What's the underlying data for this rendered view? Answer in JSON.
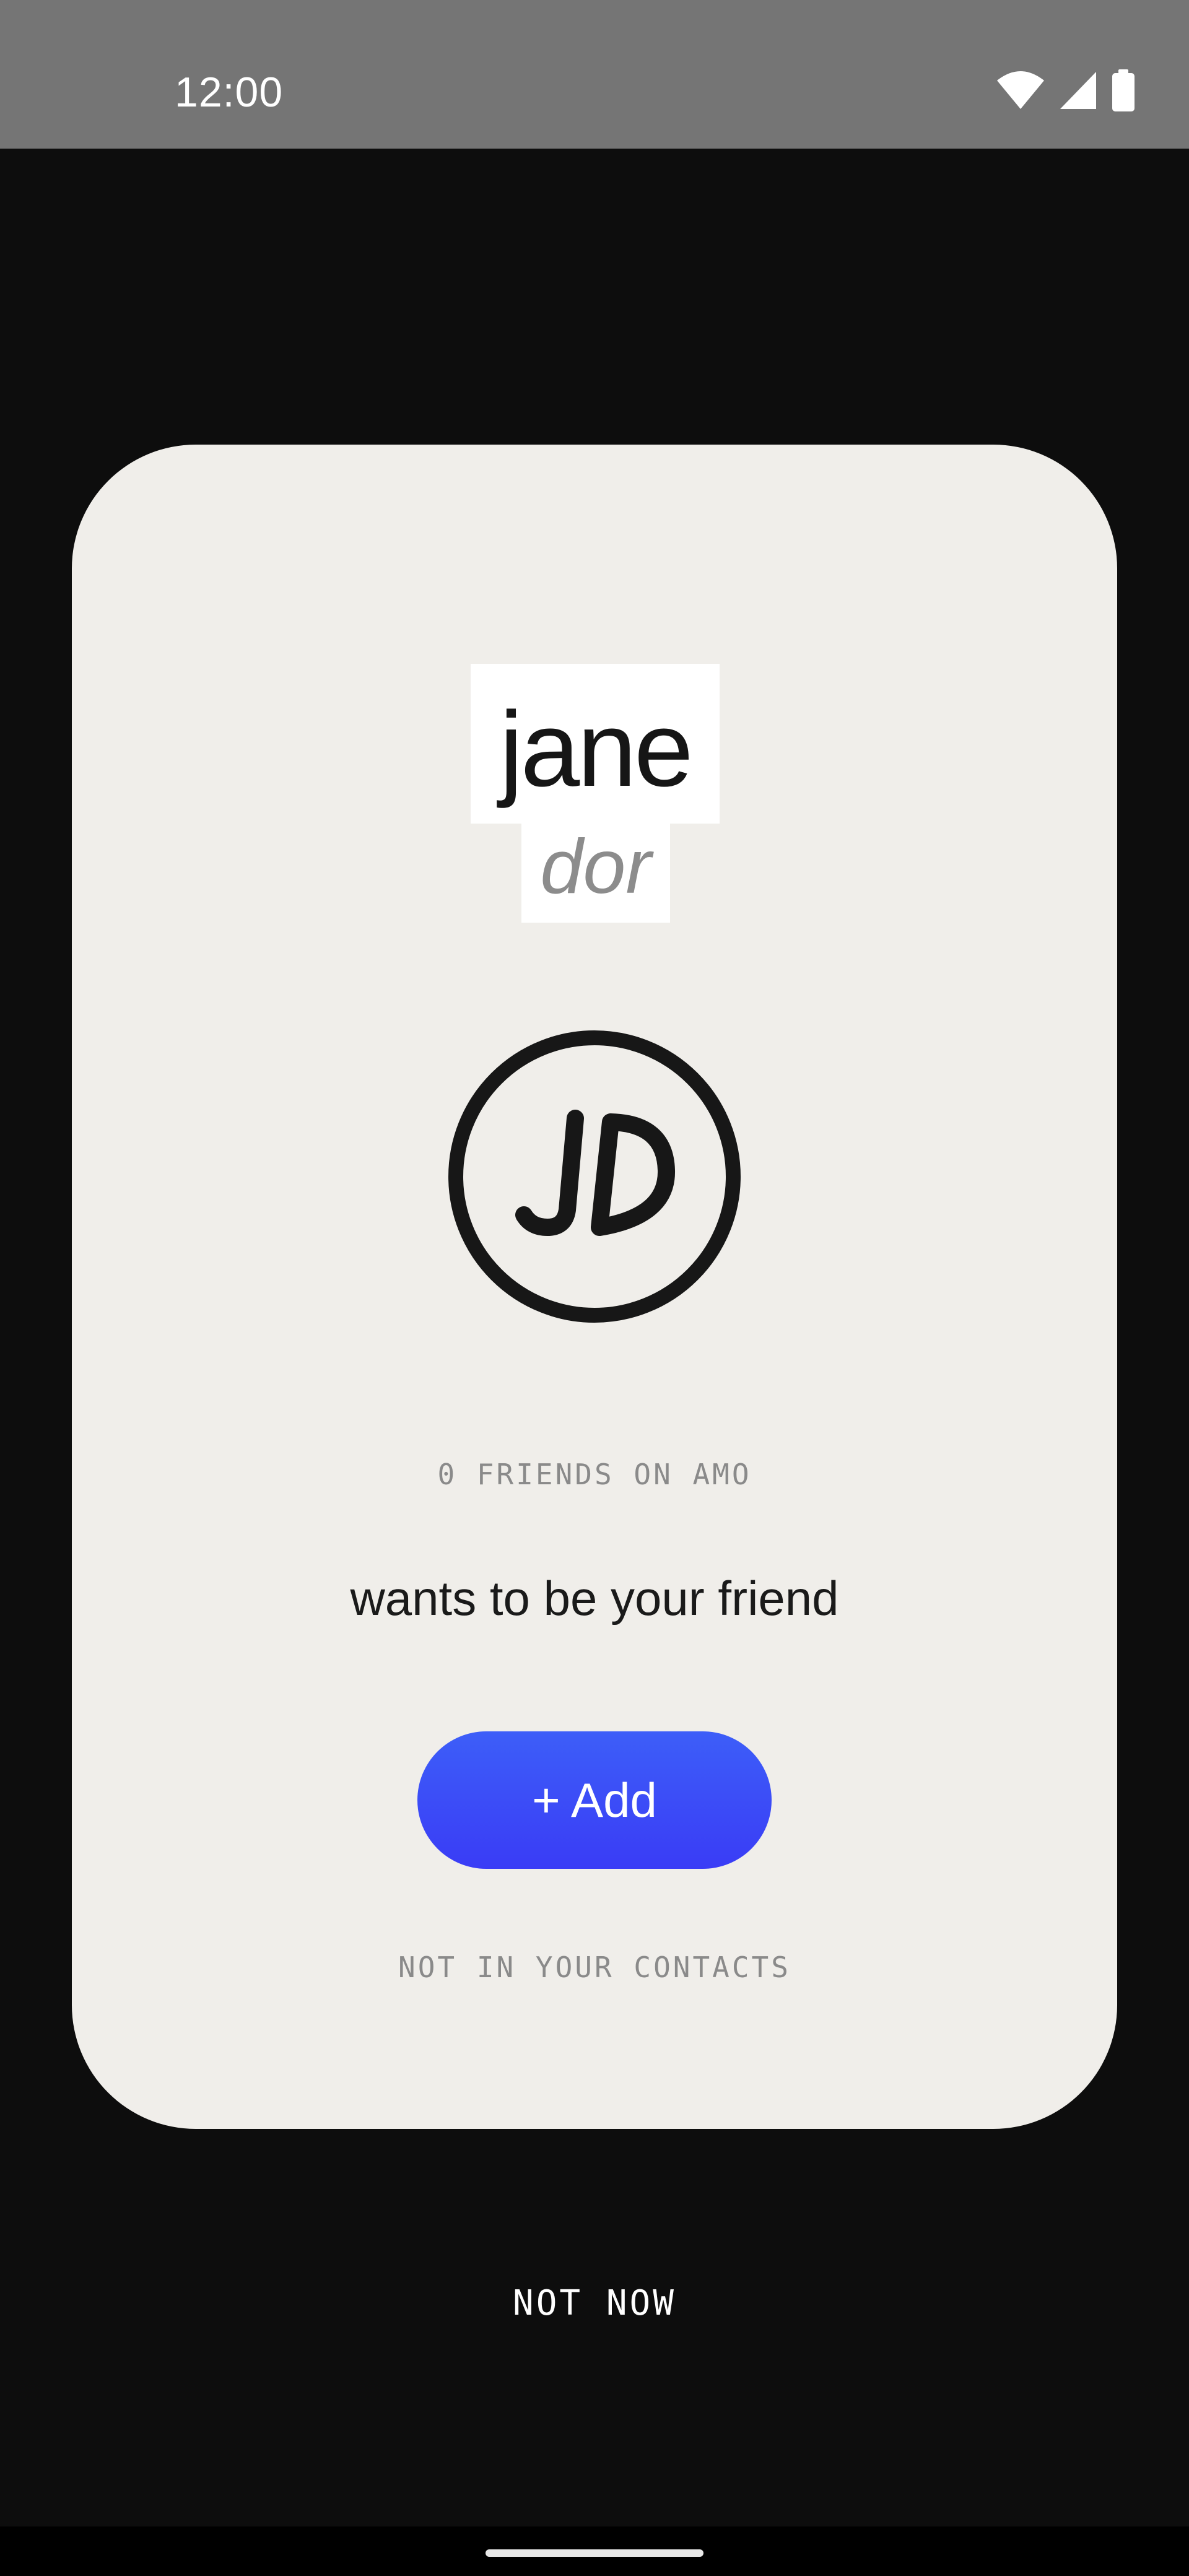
{
  "status_bar": {
    "time": "12:00",
    "icons": [
      "wifi-icon",
      "cellular-signal-icon",
      "battery-icon"
    ]
  },
  "friend_request": {
    "first_name": "jane",
    "last_name": "dor",
    "avatar_initials": "JD",
    "friends_count": "0 FRIENDS ON AMO",
    "message": "wants to be your friend",
    "add_button_label": "+ Add",
    "contacts_note": "NOT IN YOUR CONTACTS"
  },
  "actions": {
    "not_now_label": "NOT NOW"
  },
  "colors": {
    "background": "#0d0d0d",
    "status_bar": "#757575",
    "card": "#f0eeea",
    "accent": "#3a4cf7",
    "muted_text": "#8a8a8a"
  }
}
